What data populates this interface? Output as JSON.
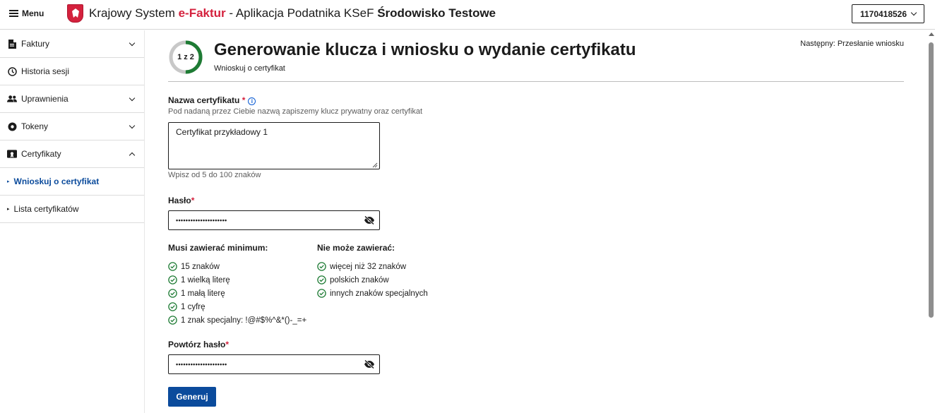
{
  "header": {
    "menu_label": "Menu",
    "title_prefix": "Krajowy System ",
    "title_brand": "e-Faktur",
    "title_middle": " - Aplikacja Podatnika KSeF ",
    "title_env": "Środowisko Testowe",
    "nip_value": "1170418526"
  },
  "sidebar": {
    "items": [
      {
        "label": "Faktury",
        "icon": "document-icon",
        "expandable": true
      },
      {
        "label": "Historia sesji",
        "icon": "clock-icon",
        "expandable": false
      },
      {
        "label": "Uprawnienia",
        "icon": "users-icon",
        "expandable": true
      },
      {
        "label": "Tokeny",
        "icon": "token-icon",
        "expandable": true
      },
      {
        "label": "Certyfikaty",
        "icon": "certificate-icon",
        "expandable": true,
        "expanded": true
      }
    ],
    "subitems": [
      {
        "label": "Wnioskuj o certyfikat",
        "active": true
      },
      {
        "label": "Lista certyfikatów",
        "active": false
      }
    ]
  },
  "main": {
    "step_indicator": "1 z 2",
    "step_progress": 0.5,
    "title": "Generowanie klucza i wniosku o wydanie certyfikatu",
    "subtitle": "Wnioskuj o certyfikat",
    "next_step": "Następny: Przesłanie wniosku",
    "cert_name": {
      "label": "Nazwa certyfikatu",
      "required_mark": "*",
      "hint": "Pod nadaną przez Ciebie nazwą zapiszemy klucz prywatny oraz certyfikat",
      "value": "Certyfikat przykładowy 1",
      "length_hint": "Wpisz od 5 do 100 znaków"
    },
    "password": {
      "label": "Hasło",
      "required_mark": "*",
      "masked_value": "•••••••••••••••••••••"
    },
    "rules_must": {
      "title": "Musi zawierać minimum:",
      "items": [
        "15 znaków",
        "1 wielką literę",
        "1 małą literę",
        "1 cyfrę",
        "1 znak specjalny: !@#$%^&*()-_=+"
      ]
    },
    "rules_cannot": {
      "title": "Nie może zawierać:",
      "items": [
        "więcej niż 32 znaków",
        "polskich znaków",
        "innych znaków specjalnych"
      ]
    },
    "password_repeat": {
      "label": "Powtórz hasło",
      "required_mark": "*",
      "masked_value": "•••••••••••••••••••••"
    },
    "generate_label": "Generuj"
  },
  "colors": {
    "brand_red": "#d4213d",
    "primary_blue": "#0b4b9c",
    "success_green": "#1e7b34",
    "step_ring_track": "#c8c8c8"
  }
}
